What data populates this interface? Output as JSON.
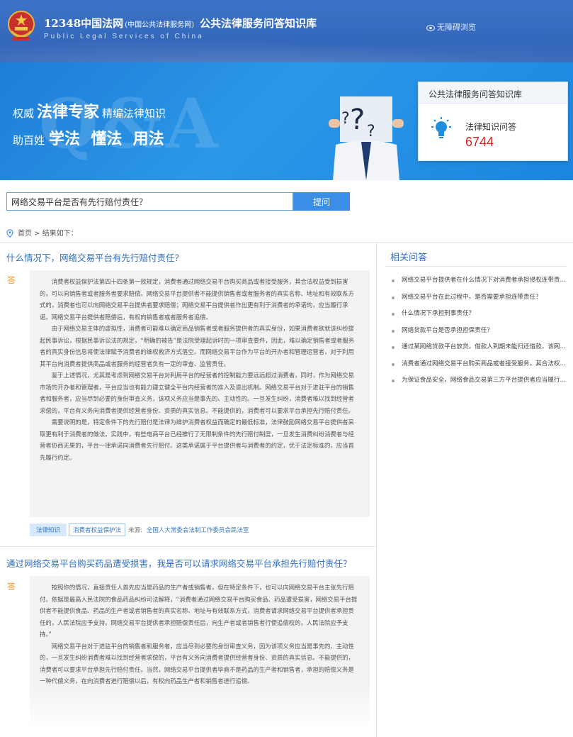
{
  "header": {
    "site_name": "12348中国法网",
    "site_name_sub": "(中国公共法律服务网)",
    "kb_name": "公共法律服务问答知识库",
    "site_name_en": "Public Legal Services of China",
    "accessibility": "无障碍浏览"
  },
  "banner": {
    "slogan1_a": "权威",
    "slogan1_b": "法律专家",
    "slogan1_c": "精编法律知识",
    "slogan2_a": "助百姓",
    "slogan2_b": "学法  懂法  用法",
    "stat_card": {
      "title": "公共法律服务问答知识库",
      "label": "法律知识问答",
      "count": "6744"
    }
  },
  "search": {
    "value": "网络交易平台是否有先行赔付责任？",
    "button": "提问"
  },
  "breadcrumb": {
    "home": "首页",
    "separator": " > ",
    "current": "结果如下："
  },
  "results": [
    {
      "question": "什么情况下，网络交易平台有先行赔付责任？",
      "answer_label": "答",
      "paragraphs": [
        "消费者权益保护法第四十四条第一款规定，消费者通过网络交易平台购买商品或者接受服务，其合法权益受到损害的，可以向销售者或者服务者要求赔偿。网络交易平台提供者不能提供销售者或者服务者的真实名称、地址和有效联系方式的，消费者也可以向网络交易平台提供者要求赔偿；网络交易平台提供者作出更有利于消费者的承诺的，应当履行承诺。网络交易平台提供者赔偿后，有权向销售者或者服务者追偿。",
        "由于网络交易主体的虚拟性，消费者可能难以确定商品销售者或者服务提供者的真实身份，如果消费者欲就该纠纷提起民事诉讼，根据民事诉讼法的规定，“明确的被告”是法院受理起诉时的一项审查要件，因此，难以确定销售者或者服务者的真实身份信息将使法律赋予消费者的维权救济方式落空。而网络交易平台作为平台的开办者和管理运营者，对于利用其平台向消费者提供商品或者服务的经营者负有一定的审查、监管责任。",
        "鉴于上述情况，尤其是考虑到网络交易平台对利用平台的经营者的控制能力要远远超过消费者，同时，作为网络交易市场的开办者和管理者，平台应当也有能力建立健全平台内经营者的准入及退出机制。网络交易平台对于进驻平台的销售者和服务者，应当尽到必要的身份审查义务，该项义务应当是事先的、主动性的。一旦发生纠纷，消费者难以找到经营者求偿的，平台有义务向消费者提供经营者身份、资质的真实信息。不能提供的，消费者可以要求平台承担先行赔付责任。",
        "需要说明的是，特定条件下的先行赔付是法律为维护消费者权益而确定的最低标准，法律鼓励网络交易平台提供者采取更有利于消费者的做法。实践中，有些电商平台已经推行了无限制条件的先行赔付制度，一旦发生消费纠纷消费者与经营者协商无果的，平台一律承诺向消费者先行赔付。这类承诺属于平台提供者与消费者的约定，优于法定标准的，应当首先履行约定。"
      ],
      "tags": [
        "法律知识",
        "消费者权益保护法"
      ],
      "source_label": "来源:",
      "source": "全国人大常委会法制工作委员会民法室"
    },
    {
      "question": "通过网络交易平台购买药品遭受损害，我是否可以请求网络交易平台承担先行赔付责任？",
      "answer_label": "答",
      "paragraphs": [
        "按照你的情况，直接责任人首先应当是药品的生产者或销售者，但在特定条件下，也可以向网络交易平台主张先行赔付。依据是最高人民法院的食品药品纠纷司法解释，“消费者通过网络交易平台购买食品、药品遭受损害，网络交易平台提供者不能提供食品、药品的生产者或者销售者的真实名称、地址与有效联系方式，消费者请求网络交易平台提供者承担责任的，人民法院应予支持。网络交易平台提供者承担赔偿责任后，向生产者或者销售者行使追偿权的，人民法院应予支持。”",
        "网络交易平台对于进驻平台的销售者和服务者，应当尽到必要的身份审查义务，因为该项义务应当是事先的、主动性的，一旦发生纠纷消费者难以找到经营者求偿的，平台有义务向消费者提供经营者身份、资质的真实信息。不能提供的，消费者可以要求平台承担先行赔付责任。当然，网络交易平台提供者毕竟不是药品的生产者和销售者，承担的赔偿义务是一种代偿义务，在向消费者进行赔偿以后，有权向药品生产者和销售者进行追偿。"
      ]
    }
  ],
  "related": {
    "title": "相关问答",
    "items": [
      "网络交易平台提供者在什么情况下对消费者承担侵权连带责任？",
      "网络交易平台在此过程中，是否需要承担连带责任？",
      "什么情况下承担刑事责任？",
      "网络贷款平台是否承担担保责任？",
      "通过某网络贷款平台放贷，借款人到期未能归还借款，该网络贷款平台是否应承担责任？",
      "消费者通过网络交易平台购买商品或者接受服务，其合法权益受到损害的，可以向谁要求赔偿？",
      "为保证食品安全，网络食品交易第三方平台提供者应当履行哪些义务？"
    ]
  },
  "colors": {
    "header_bg": "#3d73c6",
    "banner_bg": "#2b97e8",
    "link": "#2f6fc4",
    "count": "#e02020",
    "answer_label": "#f39a1e"
  }
}
